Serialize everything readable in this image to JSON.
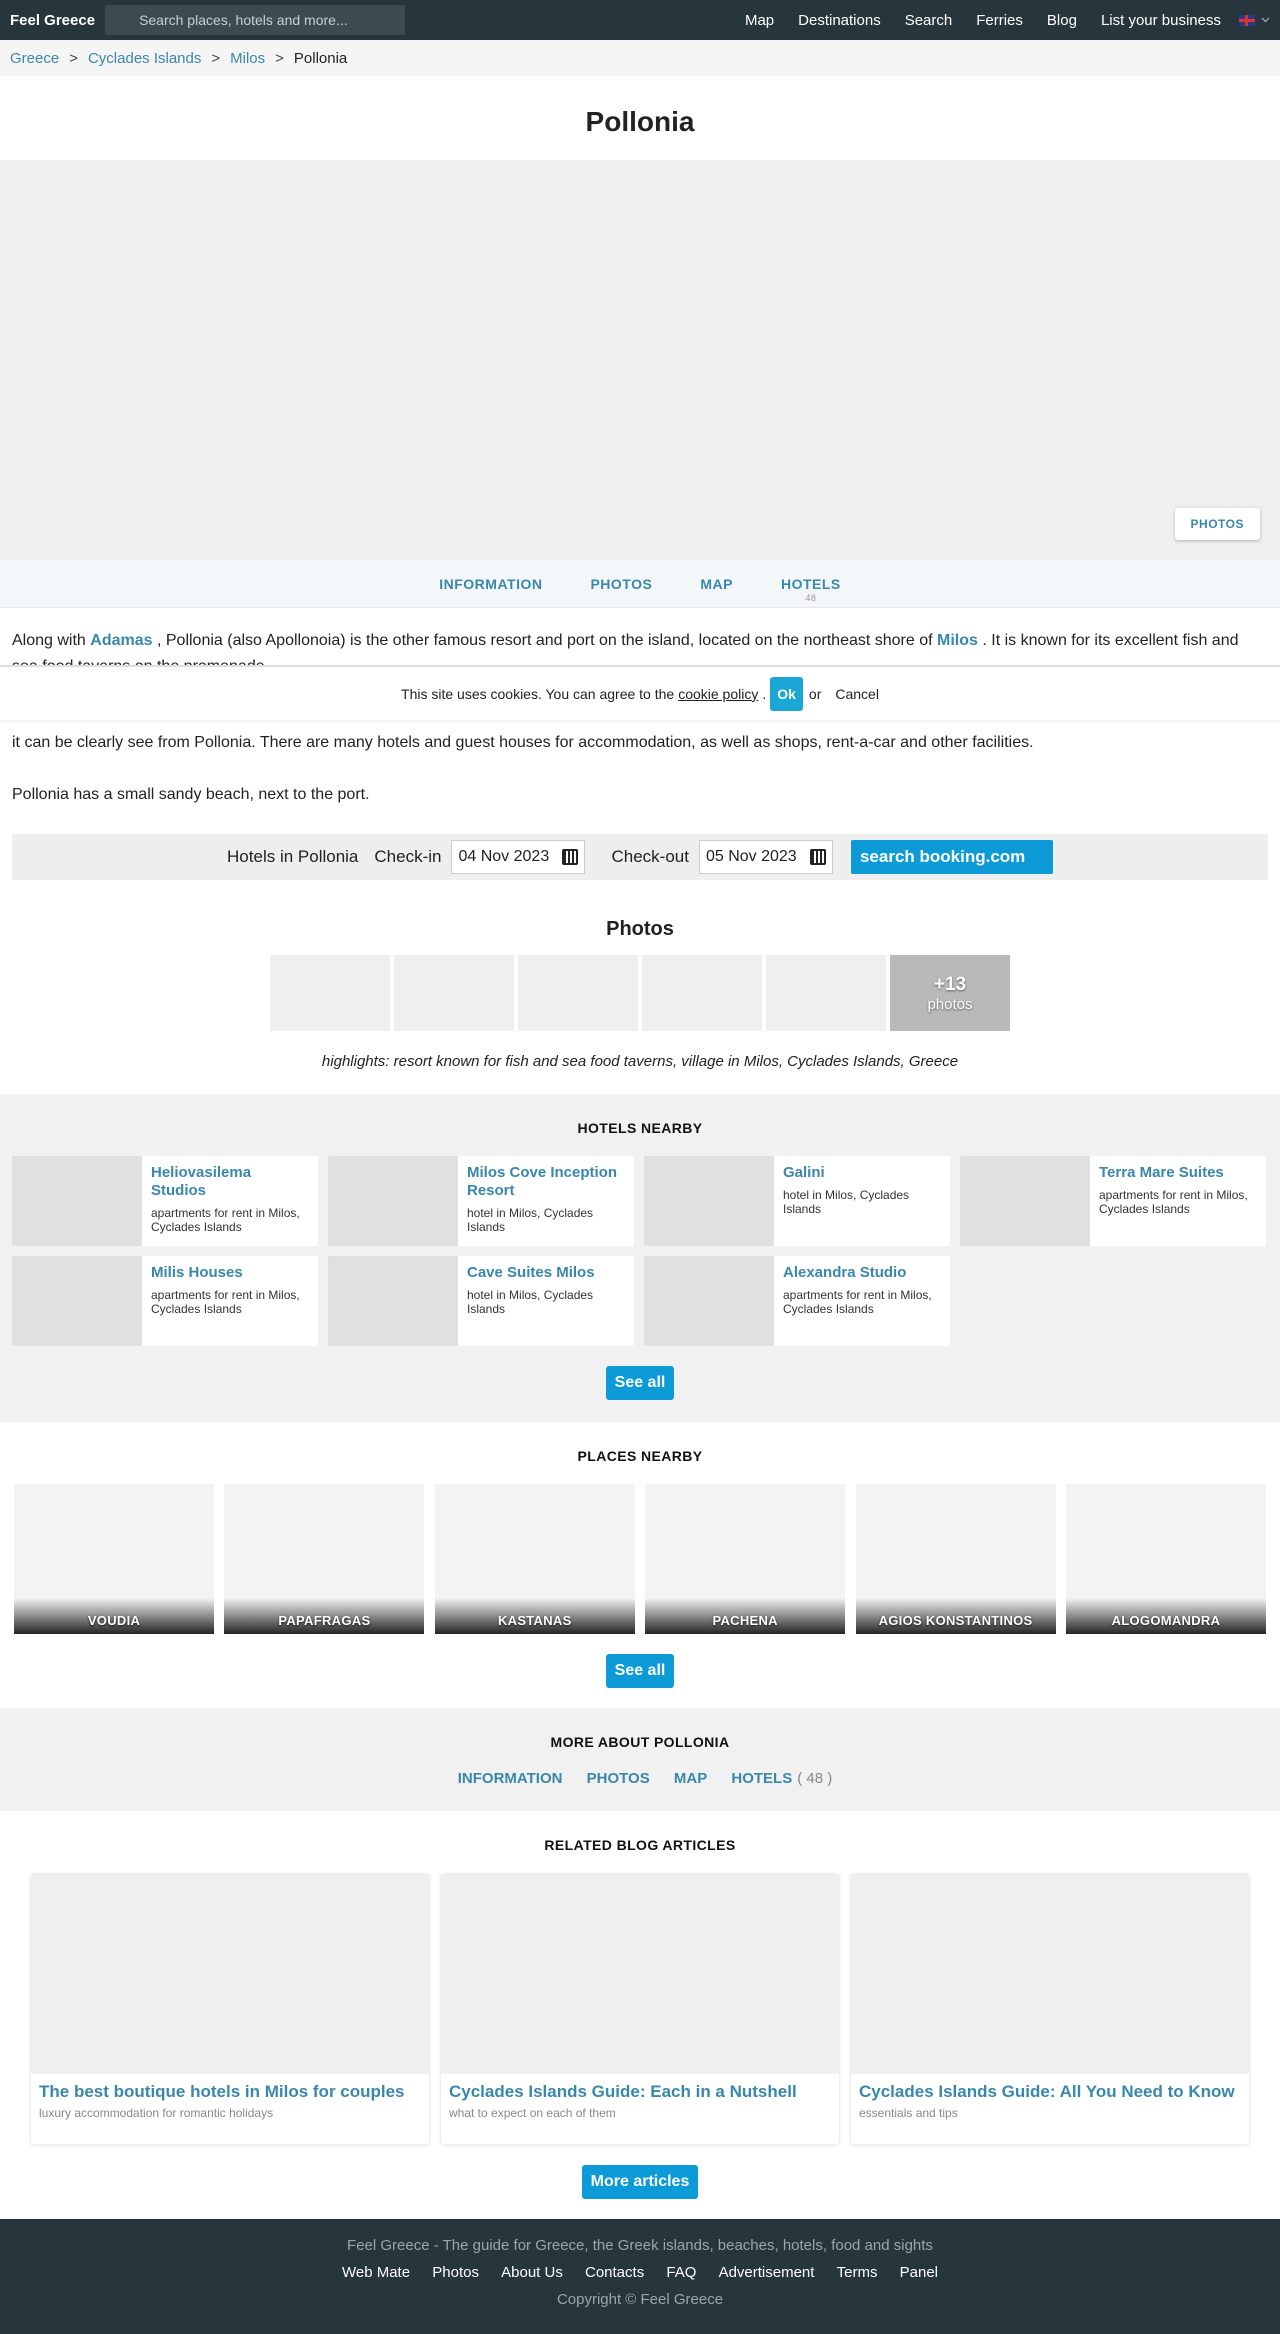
{
  "topbar": {
    "brand": "Feel Greece",
    "search_placeholder": "Search places, hotels and more...",
    "nav": [
      "Map",
      "Destinations",
      "Search",
      "Ferries",
      "Blog",
      "List your business"
    ]
  },
  "breadcrumb": [
    "Greece",
    "Cyclades Islands",
    "Milos",
    "Pollonia"
  ],
  "page_title": "Pollonia",
  "hero": {
    "photos_button": "PHOTOS"
  },
  "subnav": {
    "items": [
      "INFORMATION",
      "PHOTOS",
      "MAP",
      "HOTELS"
    ],
    "hotels_count": "48"
  },
  "content": {
    "p1_pre": "Along with",
    "p1_link1": "Adamas",
    "p1_mid": ", Pollonia (also Apollonoia) is the other famous resort and port on the island, located on the northeast shore of",
    "p1_link2": "Milos",
    "p1_post": ". It is known for its excellent fish and sea food taverns on the promenade.",
    "p2": "it can be clearly see from Pollonia. There are many hotels and guest houses for accommodation, as well as shops, rent-a-car and other facilities.",
    "p3": "Pollonia has a small sandy beach, next to the port."
  },
  "cookie": {
    "text": "This site uses cookies. You can agree to the",
    "policy": "cookie policy",
    "dot": ".",
    "ok": "Ok",
    "or": "or",
    "cancel": "Cancel"
  },
  "booking": {
    "label": "Hotels in Pollonia",
    "checkin_label": "Check-in",
    "checkin": "04 Nov 2023",
    "checkout_label": "Check-out",
    "checkout": "05 Nov 2023",
    "button": "search booking.com"
  },
  "photos": {
    "heading": "Photos",
    "more_count": "+13",
    "more_label": "photos",
    "highlights": "highlights: resort known for fish and sea food taverns, village in Milos, Cyclades Islands, Greece"
  },
  "hotels_nearby": {
    "title": "HOTELS NEARBY",
    "items": [
      {
        "name": "Heliovasilema Studios",
        "desc": "apartments for rent in Milos, Cyclades Islands"
      },
      {
        "name": "Milos Cove Inception Resort",
        "desc": "hotel in Milos, Cyclades Islands"
      },
      {
        "name": "Galini",
        "desc": "hotel in Milos, Cyclades Islands"
      },
      {
        "name": "Terra Mare Suites",
        "desc": "apartments for rent in Milos, Cyclades Islands"
      },
      {
        "name": "Milis Houses",
        "desc": "apartments for rent in Milos, Cyclades Islands"
      },
      {
        "name": "Cave Suites Milos",
        "desc": "hotel in Milos, Cyclades Islands"
      },
      {
        "name": "Alexandra Studio",
        "desc": "apartments for rent in Milos, Cyclades Islands"
      }
    ],
    "see_all": "See all"
  },
  "places_nearby": {
    "title": "PLACES NEARBY",
    "items": [
      "VOUDIA",
      "PAPAFRAGAS",
      "KASTANAS",
      "PACHENA",
      "AGIOS KONSTANTINOS",
      "ALOGOMANDRA"
    ],
    "see_all": "See all"
  },
  "more_about": {
    "title": "MORE ABOUT POLLONIA",
    "links": [
      "INFORMATION",
      "PHOTOS",
      "MAP",
      "HOTELS"
    ],
    "hotels_count": "( 48 )"
  },
  "blog": {
    "title": "RELATED BLOG ARTICLES",
    "articles": [
      {
        "title": "The best boutique hotels in Milos for couples",
        "sub": "luxury accommodation for romantic holidays"
      },
      {
        "title": "Cyclades Islands Guide: Each in a Nutshell",
        "sub": "what to expect on each of them"
      },
      {
        "title": "Cyclades Islands Guide: All You Need to Know",
        "sub": "essentials and tips"
      }
    ],
    "more": "More articles"
  },
  "footer": {
    "tagline": "Feel Greece - The guide for Greece, the Greek islands, beaches, hotels, food and sights",
    "links": [
      "Web Mate",
      "Photos",
      "About Us",
      "Contacts",
      "FAQ",
      "Advertisement",
      "Terms",
      "Panel"
    ],
    "copyright": "Copyright © Feel Greece"
  },
  "colors": {
    "accent": "#0c9bd6",
    "link": "#3a87ad",
    "nav_bg": "#27353c"
  },
  "icons": [
    "search-icon",
    "flag-uk-icon",
    "chevron-down-icon",
    "calendar-icon"
  ]
}
